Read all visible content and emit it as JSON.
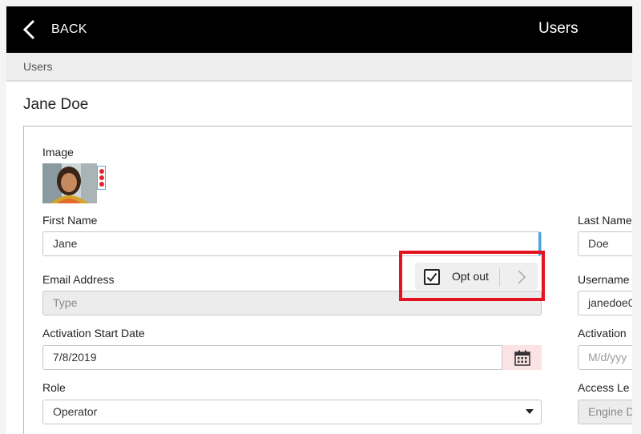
{
  "topbar": {
    "back_label": "BACK",
    "title": "Users"
  },
  "breadcrumb": "Users",
  "user": {
    "name": "Jane Doe"
  },
  "form": {
    "image_label": "Image",
    "first_name_label": "First Name",
    "first_name_value": "Jane",
    "last_name_label": "Last Name",
    "last_name_value": "Doe",
    "email_label": "Email Address",
    "email_placeholder": "Type",
    "username_label": "Username",
    "username_value": "janedoe0",
    "activation_start_label": "Activation Start Date",
    "activation_start_value": "7/8/2019",
    "activation_end_label": "Activation",
    "activation_end_placeholder": "M/d/yyy",
    "role_label": "Role",
    "role_value": "Operator",
    "access_level_label": "Access Le",
    "access_level_value": "Engine D"
  },
  "opt_out": {
    "label": "Opt out",
    "checked": true
  },
  "colors": {
    "highlight": "#e3141f",
    "focus": "#4aa3d9",
    "kebab_dots": "#e0252c"
  }
}
